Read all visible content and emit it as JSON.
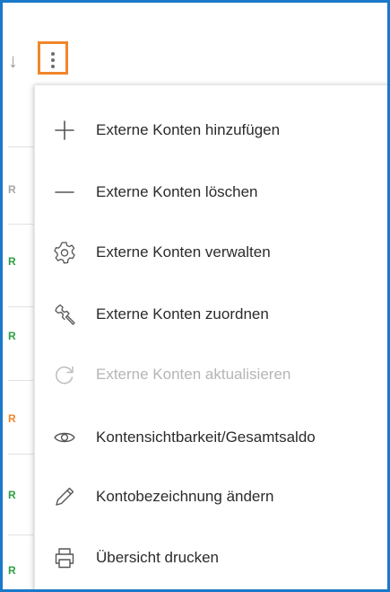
{
  "background": {
    "sort_icon": "arrow-down-icon",
    "row_markers": [
      {
        "letter": "R",
        "color": "#a6a6a6"
      },
      {
        "letter": "R",
        "color": "#2ea043"
      },
      {
        "letter": "R",
        "color": "#2ea043"
      },
      {
        "letter": "R",
        "color": "#f0862b"
      },
      {
        "letter": "R",
        "color": "#2ea043"
      },
      {
        "letter": "R",
        "color": "#2ea043"
      }
    ]
  },
  "kebab": {
    "icon": "more-vertical-icon",
    "highlight_color": "#f0862b"
  },
  "menu": {
    "items": [
      {
        "label": "Externe Konten hinzufügen",
        "icon": "plus-icon",
        "disabled": false
      },
      {
        "label": "Externe Konten löschen",
        "icon": "minus-icon",
        "disabled": false
      },
      {
        "label": "Externe Konten verwalten",
        "icon": "gear-icon",
        "disabled": false
      },
      {
        "label": "Externe Konten zuordnen",
        "icon": "wrench-icon",
        "disabled": false
      },
      {
        "label": "Externe Konten aktualisieren",
        "icon": "refresh-icon",
        "disabled": true
      },
      {
        "label": "Kontensichtbarkeit/Gesamtsaldo",
        "icon": "eye-icon",
        "disabled": false
      },
      {
        "label": "Kontobezeichnung ändern",
        "icon": "pencil-icon",
        "disabled": false
      },
      {
        "label": "Übersicht drucken",
        "icon": "printer-icon",
        "disabled": false
      }
    ]
  },
  "colors": {
    "frame": "#1a79c8",
    "text": "#2b2b2b",
    "disabled_text": "#b5b5b5",
    "icon": "#555555"
  }
}
